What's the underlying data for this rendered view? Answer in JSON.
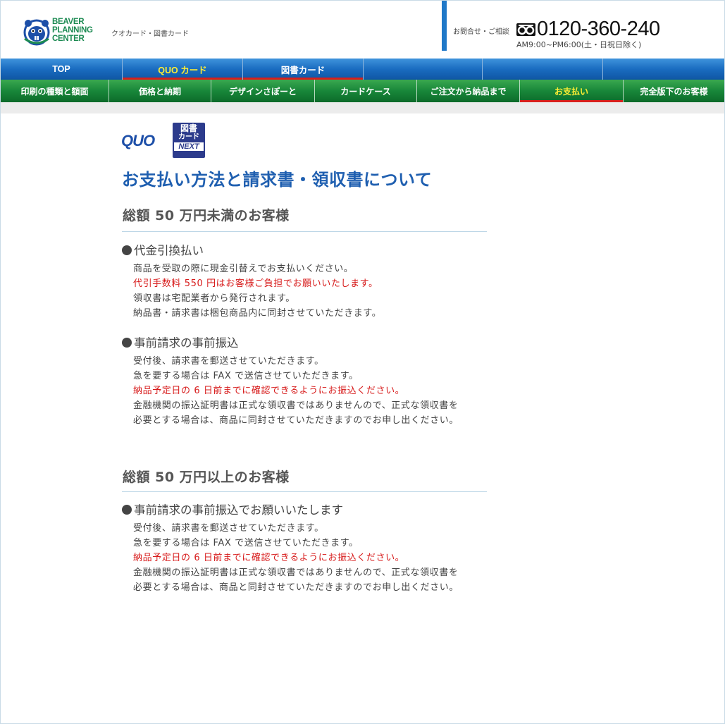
{
  "header": {
    "logo": {
      "line1": "BEAVER",
      "line2": "PLANNING",
      "line3": "CENTER"
    },
    "tagline": "クオカード・図書カード",
    "contact_label": "お問合せ・ご相談",
    "phone_number": "0120-360-240",
    "hours": "AM9:00~PM6:00(土・日祝日除く)"
  },
  "top_nav": [
    {
      "label": "TOP",
      "style": "white"
    },
    {
      "label": "QUO カード",
      "style": "yellow"
    },
    {
      "label": "図書カード",
      "style": "white"
    },
    {
      "label": ""
    },
    {
      "label": ""
    },
    {
      "label": ""
    }
  ],
  "green_nav": [
    {
      "label": "印刷の種類と額面"
    },
    {
      "label": "価格と納期"
    },
    {
      "label": "デザインさぽーと"
    },
    {
      "label": "カードケース"
    },
    {
      "label": "ご注文から納品まで"
    },
    {
      "label": "お支払い",
      "current": true
    },
    {
      "label": "完全版下のお客様"
    }
  ],
  "brand_logos": {
    "quo": "QUO",
    "tosho_line1": "図書",
    "tosho_line2": "カード",
    "tosho_line3": "NEXT"
  },
  "page_title": "お支払い方法と請求書・領収書について",
  "sections": [
    {
      "heading": "総額 50 万円未満のお客様",
      "items": [
        {
          "title": "代金引換払い",
          "lines": [
            {
              "text": "商品を受取の際に現金引替えでお支払いください。"
            },
            {
              "text": "代引手数料 550 円はお客様ご負担でお願いいたします。",
              "red": true
            },
            {
              "text": "領収書は宅配業者から発行されます。"
            },
            {
              "text": "納品書・請求書は梱包商品内に同封させていただきます。"
            }
          ]
        },
        {
          "title": "事前請求の事前振込",
          "lines": [
            {
              "text": "受付後、請求書を郵送させていただきます。"
            },
            {
              "text": "急を要する場合は FAX で送信させていただきます。"
            },
            {
              "text": "納品予定日の 6 日前までに確認できるようにお振込ください。",
              "red": true
            },
            {
              "text": "金融機関の振込証明書は正式な領収書ではありませんので、正式な領収書を"
            },
            {
              "text": "必要とする場合は、商品に同封させていただきますのでお申し出ください。"
            }
          ]
        }
      ]
    },
    {
      "heading": "総額 50 万円以上のお客様",
      "items": [
        {
          "title": "事前請求の事前振込でお願いいたします",
          "lines": [
            {
              "text": "受付後、請求書を郵送させていただきます。"
            },
            {
              "text": "急を要する場合は FAX で送信させていただきます。"
            },
            {
              "text": "納品予定日の 6 日前までに確認できるようにお振込ください。",
              "red": true
            },
            {
              "text": "金融機関の振込証明書は正式な領収書ではありませんので、正式な領収書を"
            },
            {
              "text": "必要とする場合は、商品と同封させていただきますのでお申し出ください。"
            }
          ]
        }
      ]
    }
  ],
  "colors": {
    "title_blue": "#1f5fb0",
    "nav_blue": "#1a6cc0",
    "nav_green": "#18873a",
    "active_yellow": "#ffee33",
    "alert_red": "#d71a1a",
    "divider_blue": "#1f78c8"
  },
  "icons": {
    "phone": "free-dial-icon",
    "logo": "beaver-logo-icon"
  }
}
